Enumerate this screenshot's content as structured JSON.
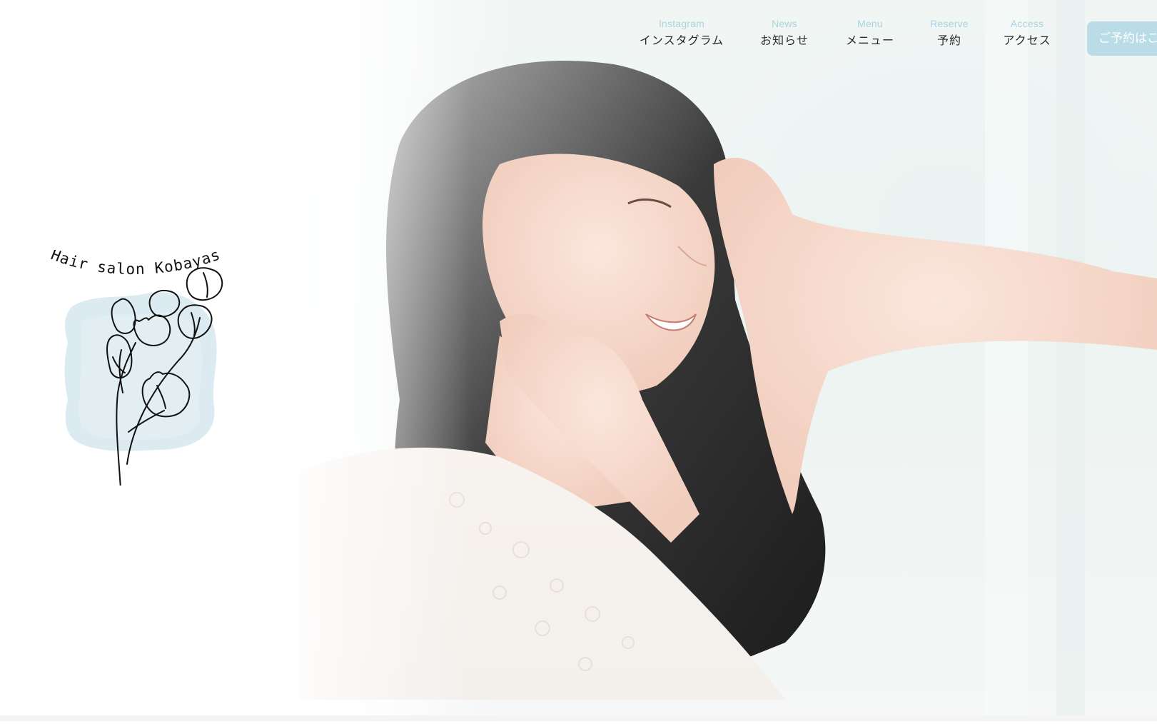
{
  "header": {
    "nav": [
      {
        "en": "Instagram",
        "ja": "インスタグラム"
      },
      {
        "en": "News",
        "ja": "お知らせ"
      },
      {
        "en": "Menu",
        "ja": "メニュー"
      },
      {
        "en": "Reserve",
        "ja": "予約"
      },
      {
        "en": "Access",
        "ja": "アクセス"
      }
    ],
    "cta_label": "ご予約はこちら"
  },
  "logo": {
    "text": "Hair salon Kobayas",
    "icon": "tulip-line-art-icon"
  },
  "hero": {
    "image": "smiling-woman-touching-hair-photo"
  },
  "colors": {
    "accent_light_blue": "#a9d3e0",
    "cta_background": "#b9dce7",
    "nav_text": "#2a2a2a"
  }
}
